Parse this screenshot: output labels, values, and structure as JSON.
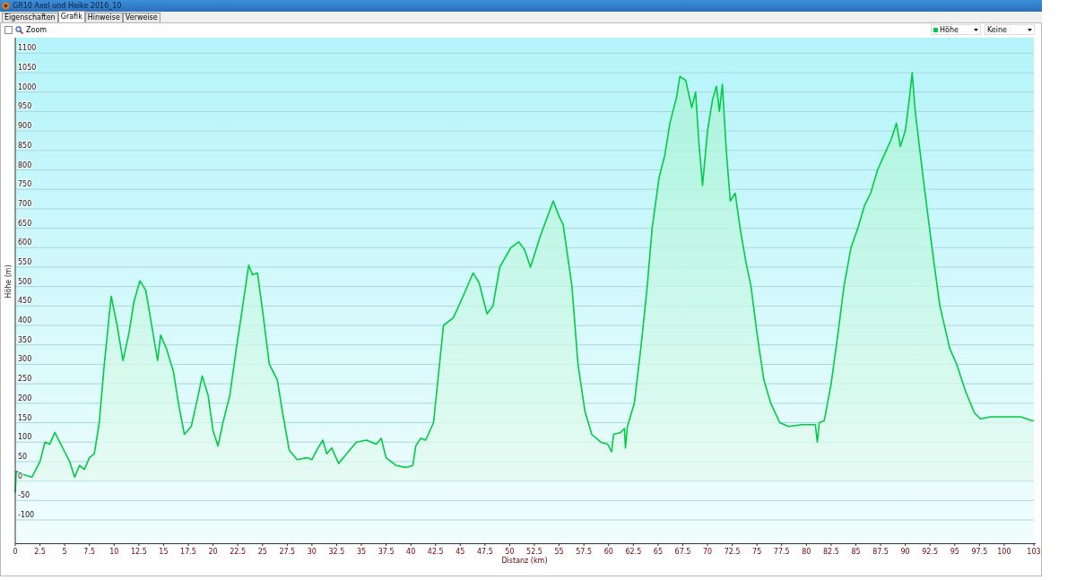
{
  "window": {
    "title": "GR10 Axel und Heike 2016_10"
  },
  "tabs": [
    {
      "label": "Eigenschaften",
      "selected": false
    },
    {
      "label": "Grafik",
      "selected": true
    },
    {
      "label": "Hinweise",
      "selected": false
    },
    {
      "label": "Verweise",
      "selected": false
    }
  ],
  "toolbar": {
    "zoom": {
      "label": "Zoom",
      "checked": false
    },
    "dropdowns": [
      {
        "kind": "series"
      },
      {
        "kind": "plain",
        "value": "Keine"
      }
    ]
  },
  "chart": {
    "chart_data": {
      "type": "area",
      "grid": true,
      "xlabel": "Distanz  (km)",
      "ylabel": "Höhe (m)",
      "xlim": [
        0,
        103
      ],
      "ylim": [
        -160,
        1140
      ],
      "xticks": [
        0,
        2.5,
        5,
        7.5,
        10,
        12.5,
        15,
        17.5,
        20,
        22.5,
        25,
        27.5,
        30,
        32.5,
        35,
        37.5,
        40,
        42.5,
        45,
        47.5,
        50,
        52.5,
        55,
        57.5,
        60,
        62.5,
        65,
        67.5,
        70,
        72.5,
        75,
        77.5,
        80,
        82.5,
        85,
        87.5,
        90,
        92.5,
        95,
        97.5,
        100,
        103
      ],
      "yticks": [
        -100,
        -50,
        0,
        50,
        100,
        150,
        200,
        250,
        300,
        350,
        400,
        450,
        500,
        550,
        600,
        650,
        700,
        750,
        800,
        850,
        900,
        950,
        1000,
        1050,
        1100
      ],
      "x": [
        0,
        0.1,
        1,
        1.7,
        2.5,
        3,
        3.5,
        4,
        4.5,
        5,
        5.5,
        6,
        6.5,
        7,
        7.5,
        8,
        8.5,
        9,
        9.7,
        10.3,
        10.9,
        11.5,
        12,
        12.6,
        13.2,
        14,
        14.4,
        14.7,
        15.3,
        16,
        16.5,
        17.1,
        17.8,
        18.5,
        18.9,
        19.5,
        20,
        20.5,
        21,
        21.7,
        22.3,
        23,
        23.6,
        24,
        24.5,
        25,
        25.7,
        26.5,
        27,
        27.7,
        28.5,
        29.5,
        30,
        30.5,
        31.1,
        31.5,
        32,
        32.7,
        33.5,
        34.5,
        35.5,
        36.5,
        37,
        37.5,
        38.5,
        39.5,
        40.2,
        40.5,
        41,
        41.5,
        42.3,
        43.3,
        44.3,
        45.2,
        46.3,
        46.9,
        47.7,
        48.3,
        49,
        50.1,
        50.9,
        51.5,
        52.1,
        53.1,
        54.4,
        55,
        55.4,
        56.3,
        56.9,
        57.6,
        58.3,
        59.2,
        59.9,
        60.3,
        60.5,
        61.2,
        61.6,
        61.7,
        61.9,
        62.6,
        63.3,
        63.9,
        64.4,
        65.1,
        65.7,
        66.2,
        66.9,
        67.2,
        67.8,
        68.4,
        68.8,
        69.1,
        69.5,
        70,
        70.5,
        70.9,
        71.2,
        71.5,
        71.9,
        72.3,
        72.8,
        73.3,
        73.9,
        74.4,
        75,
        75.7,
        76.4,
        77.3,
        78.2,
        79.5,
        80.9,
        81.1,
        81.3,
        81.8,
        82.5,
        83.2,
        83.8,
        84.5,
        85.2,
        85.9,
        86.5,
        87.2,
        87.9,
        88.6,
        89.1,
        89.5,
        90,
        90.4,
        90.7,
        91,
        91.8,
        92.7,
        93.5,
        94.5,
        95.2,
        96.1,
        97,
        97.6,
        98.6,
        101.7,
        102.8,
        103
      ],
      "series": [
        {
          "name": "Höhe",
          "color": "#00cc44",
          "values": [
            -30,
            25,
            15,
            10,
            50,
            100,
            95,
            125,
            100,
            75,
            50,
            10,
            40,
            30,
            60,
            70,
            150,
            300,
            475,
            400,
            310,
            380,
            460,
            515,
            490,
            370,
            310,
            375,
            340,
            280,
            200,
            120,
            140,
            220,
            270,
            220,
            130,
            90,
            150,
            220,
            330,
            450,
            555,
            530,
            535,
            440,
            300,
            260,
            180,
            80,
            55,
            60,
            55,
            80,
            105,
            70,
            85,
            45,
            70,
            100,
            105,
            95,
            110,
            60,
            40,
            35,
            40,
            90,
            110,
            105,
            150,
            400,
            420,
            470,
            535,
            510,
            430,
            450,
            550,
            600,
            615,
            595,
            550,
            630,
            720,
            680,
            660,
            500,
            300,
            180,
            120,
            100,
            95,
            75,
            120,
            125,
            135,
            85,
            140,
            200,
            350,
            500,
            650,
            780,
            840,
            920,
            990,
            1040,
            1030,
            960,
            1000,
            880,
            760,
            900,
            980,
            1015,
            950,
            1020,
            850,
            720,
            740,
            650,
            560,
            500,
            380,
            260,
            200,
            150,
            140,
            145,
            145,
            100,
            150,
            155,
            250,
            380,
            500,
            600,
            650,
            710,
            740,
            800,
            840,
            880,
            920,
            860,
            900,
            980,
            1050,
            950,
            780,
            600,
            450,
            340,
            300,
            230,
            175,
            160,
            165,
            165,
            155,
            155
          ]
        }
      ]
    }
  }
}
